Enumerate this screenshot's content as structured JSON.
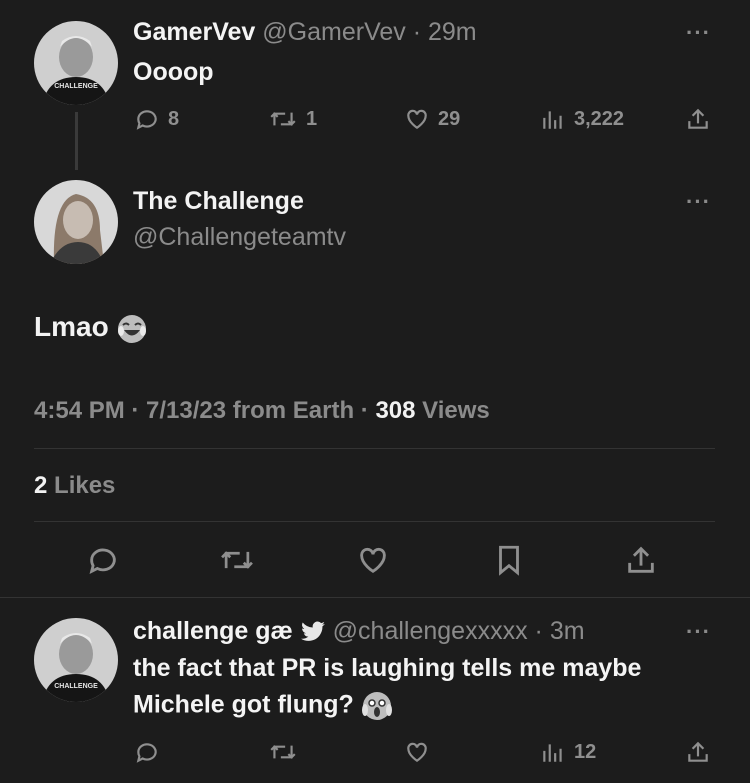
{
  "tweet1": {
    "name": "GamerVev",
    "handle": "@GamerVev",
    "time": "29m",
    "text": "Oooop",
    "replies": "8",
    "retweets": "1",
    "likes": "29",
    "views": "3,222",
    "avatar_text": "CHALLENGE"
  },
  "main_tweet": {
    "name": "The Challenge",
    "handle": "@Challengeteamtv",
    "text": "Lmao",
    "emoji": "face-with-tears-of-joy",
    "timestamp": "4:54 PM · 7/13/23 from Earth · ",
    "views_count": "308",
    "views_label": " Views",
    "likes_count": "2",
    "likes_label": " Likes"
  },
  "reply": {
    "name": "challenge gæ",
    "handle": "@challengexxxxx",
    "time": "3m",
    "text_line1": "the fact that PR is laughing tells me maybe",
    "text_line2": "Michele got flung?",
    "emoji": "face-screaming-in-fear",
    "views": "12",
    "avatar_text": "CHALLENGE"
  },
  "separator": " · ",
  "more": "···"
}
